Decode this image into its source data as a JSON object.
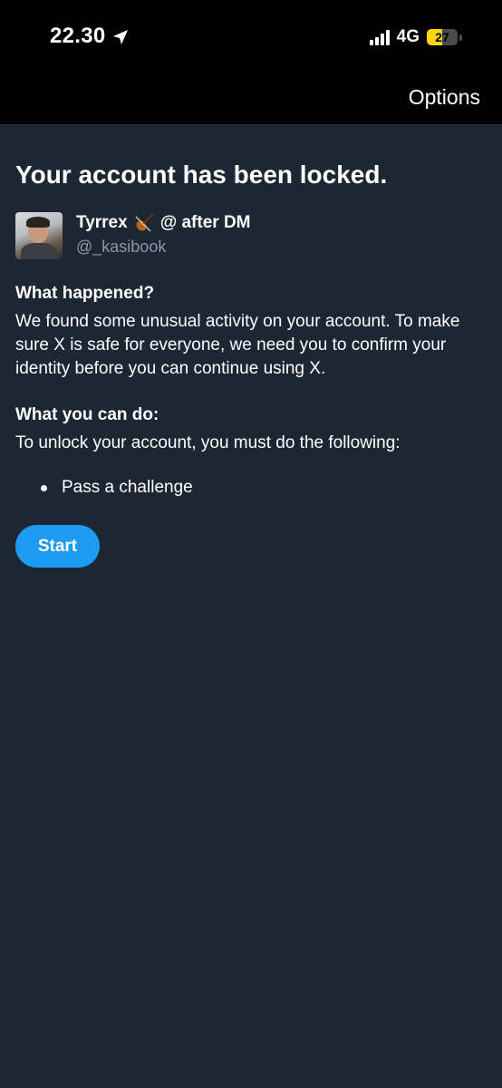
{
  "status_bar": {
    "time": "22.30",
    "network": "4G",
    "battery_level": "27",
    "battery_fill_fraction": 0.27,
    "battery_color": "#ffd60a"
  },
  "nav": {
    "options_label": "Options"
  },
  "page": {
    "title": "Your account has been locked."
  },
  "account": {
    "display_name": "Tyrrex",
    "name_suffix": "@ after DM",
    "emoji_icon": "violin-icon",
    "username": "@_kasibook"
  },
  "what_happened": {
    "heading": "What happened?",
    "body": "We found some unusual activity on your account. To make sure X is safe for everyone, we need you to confirm your identity before you can continue using X."
  },
  "what_you_can_do": {
    "heading": "What you can do:",
    "body": "To unlock your account, you must do the following:",
    "steps": [
      "Pass a challenge"
    ]
  },
  "actions": {
    "start_label": "Start"
  },
  "colors": {
    "background": "#1c2733",
    "accent": "#1d9bf0",
    "secondary_text": "#8b98a5"
  }
}
